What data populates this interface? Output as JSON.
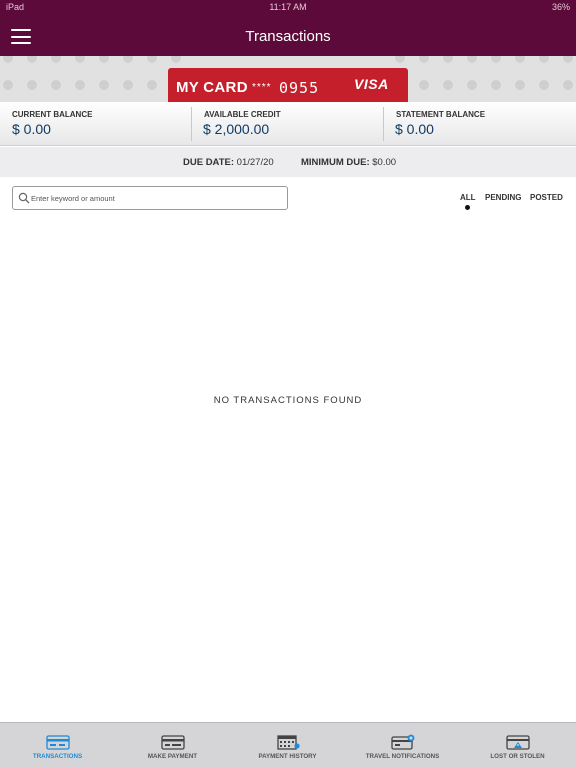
{
  "status_bar": {
    "carrier": "iPad",
    "time": "11:17 AM",
    "battery": "36%"
  },
  "header": {
    "title": "Transactions",
    "menu_icon": "hamburger-icon"
  },
  "card": {
    "name": "MY CARD",
    "masked": "****",
    "last4": "0955",
    "brand": "VISA"
  },
  "balances": [
    {
      "label": "CURRENT BALANCE",
      "value": "$ 0.00"
    },
    {
      "label": "AVAILABLE CREDIT",
      "value": "$ 2,000.00"
    },
    {
      "label": "STATEMENT BALANCE",
      "value": "$ 0.00"
    }
  ],
  "due": {
    "due_label": "DUE DATE:",
    "due_value": "01/27/20",
    "min_label": "MINIMUM DUE:",
    "min_value": "$0.00"
  },
  "search": {
    "placeholder": "Enter keyword or amount",
    "value": ""
  },
  "filters": {
    "all": "ALL",
    "pending": "PENDING",
    "posted": "POSTED",
    "selected": "ALL"
  },
  "empty_message": "NO TRANSACTIONS FOUND",
  "tabs": [
    {
      "label": "TRANSACTIONS",
      "icon": "card-transactions-icon",
      "active": true
    },
    {
      "label": "MAKE PAYMENT",
      "icon": "card-payment-icon",
      "active": false
    },
    {
      "label": "PAYMENT HISTORY",
      "icon": "calendar-icon",
      "active": false
    },
    {
      "label": "TRAVEL NOTIFICATIONS",
      "icon": "travel-card-icon",
      "active": false
    },
    {
      "label": "LOST OR STOLEN",
      "icon": "lost-card-icon",
      "active": false
    }
  ],
  "colors": {
    "header": "#5c0a3a",
    "card": "#c41f2a",
    "value_text": "#0e3b64",
    "active_tab": "#1f8ad6"
  }
}
